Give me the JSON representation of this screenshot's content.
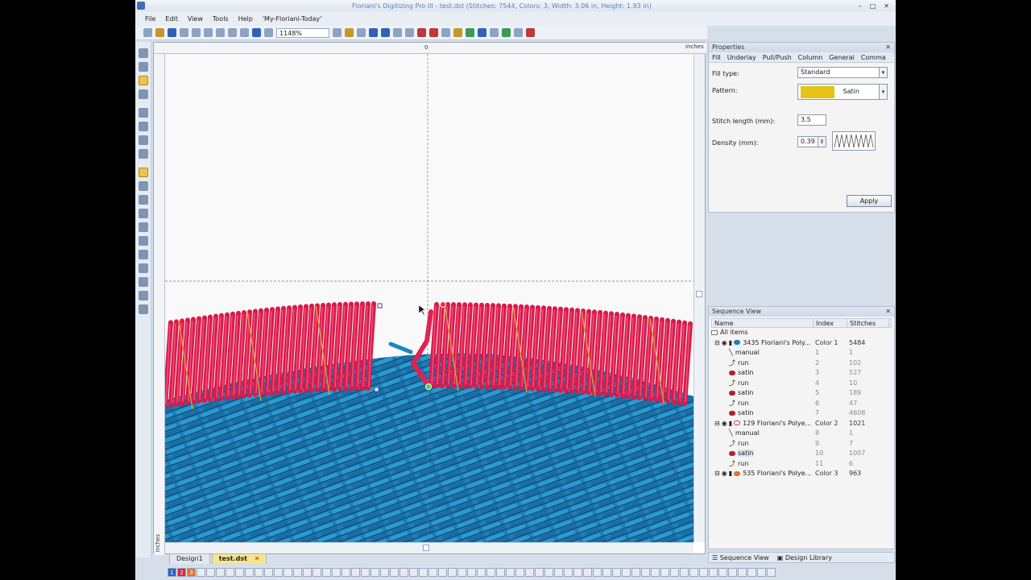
{
  "window": {
    "title": "Floriani's Digitizing Pro III - test.dst (Stitches: 7544, Colors: 3, Width: 3.06 in, Height: 1.93 in)"
  },
  "menu": {
    "items": [
      "File",
      "Edit",
      "View",
      "Tools",
      "Help",
      "'My-Floriani-Today'"
    ]
  },
  "toolbar": {
    "zoom": "1148%"
  },
  "ruler": {
    "unit": "inches",
    "origin": "0"
  },
  "tabs": {
    "items": [
      "Design1",
      "test.dst"
    ]
  },
  "colors": {
    "items": [
      "1",
      "2",
      "3"
    ],
    "swatches": [
      "#2a62c8",
      "#d3283b",
      "#e6722b"
    ]
  },
  "properties": {
    "title": "Properties",
    "tabs": [
      "Fill",
      "Underlay",
      "Pull/Push",
      "Column",
      "General",
      "Comma"
    ],
    "fill_type_label": "Fill type:",
    "fill_type_value": "Standard",
    "pattern_label": "Pattern:",
    "pattern_value": "Satin",
    "stitch_length_label": "Stitch length (mm):",
    "stitch_length_value": "3.5",
    "density_label": "Density (mm):",
    "density_value": "0.39",
    "apply_label": "Apply"
  },
  "sequence": {
    "title": "Sequence View",
    "headers": [
      "Name",
      "Index",
      "Stitches"
    ],
    "all_items": "All items",
    "rows": [
      {
        "name": "3435 Floriani's Poly...",
        "index": "Color 1",
        "stitches": "5484",
        "group": true,
        "icon": "thread-blue"
      },
      {
        "name": "manual",
        "index": "1",
        "stitches": "1",
        "icon": "manual"
      },
      {
        "name": "run",
        "index": "2",
        "stitches": "102",
        "icon": "run"
      },
      {
        "name": "satin",
        "index": "3",
        "stitches": "527",
        "icon": "satin"
      },
      {
        "name": "run",
        "index": "4",
        "stitches": "10",
        "icon": "run"
      },
      {
        "name": "satin",
        "index": "5",
        "stitches": "189",
        "icon": "satin"
      },
      {
        "name": "run",
        "index": "6",
        "stitches": "47",
        "icon": "run"
      },
      {
        "name": "satin",
        "index": "7",
        "stitches": "4608",
        "icon": "satin"
      },
      {
        "name": "129 Floriani's Polye...",
        "index": "Color 2",
        "stitches": "1021",
        "group": true,
        "icon": "thread-red"
      },
      {
        "name": "manual",
        "index": "8",
        "stitches": "1",
        "icon": "manual"
      },
      {
        "name": "run",
        "index": "9",
        "stitches": "7",
        "icon": "run"
      },
      {
        "name": "satin",
        "index": "10",
        "stitches": "1007",
        "icon": "satin",
        "selected": true
      },
      {
        "name": "run",
        "index": "11",
        "stitches": "6",
        "icon": "run"
      },
      {
        "name": "535 Floriani's Polye...",
        "index": "Color 3",
        "stitches": "963",
        "group": true,
        "icon": "thread-orange"
      }
    ],
    "bottom_tabs": [
      "Sequence View",
      "Design Library"
    ]
  }
}
